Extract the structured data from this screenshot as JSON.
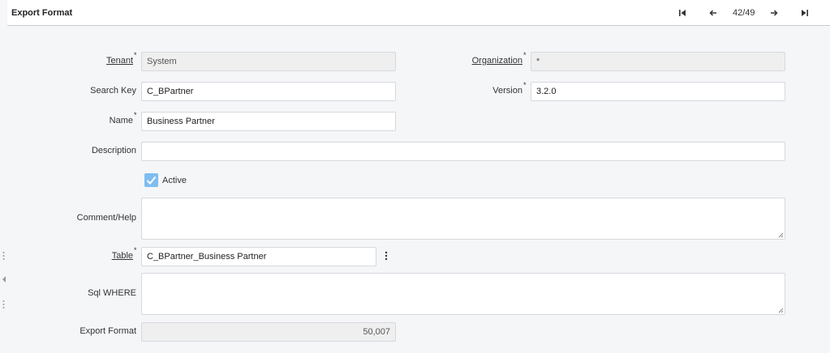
{
  "header": {
    "title": "Export Format",
    "record_counter": "42/49",
    "icons": [
      "first-record-icon",
      "previous-record-icon",
      "next-record-icon",
      "last-record-icon"
    ]
  },
  "form": {
    "tenant": {
      "label": "Tenant",
      "required_mark": "*",
      "value": "System"
    },
    "organization": {
      "label": "Organization",
      "required_mark": "*",
      "value": "*"
    },
    "search_key": {
      "label": "Search Key",
      "value": "C_BPartner"
    },
    "version": {
      "label": "Version",
      "required_mark": "*",
      "value": "3.2.0"
    },
    "name": {
      "label": "Name",
      "required_mark": "*",
      "value": "Business Partner"
    },
    "description": {
      "label": "Description",
      "value": ""
    },
    "active": {
      "label": "Active",
      "checked": true
    },
    "comment_help": {
      "label": "Comment/Help",
      "value": ""
    },
    "table": {
      "label": "Table",
      "required_mark": "*",
      "value": "C_BPartner_Business Partner"
    },
    "sql_where": {
      "label": "Sql WHERE",
      "value": ""
    },
    "export_format": {
      "label": "Export Format",
      "value": "50,007"
    }
  },
  "colors": {
    "checkbox": "#7fbdf0",
    "readonly_field": "#efefef",
    "page_background": "#f5f6f8"
  }
}
